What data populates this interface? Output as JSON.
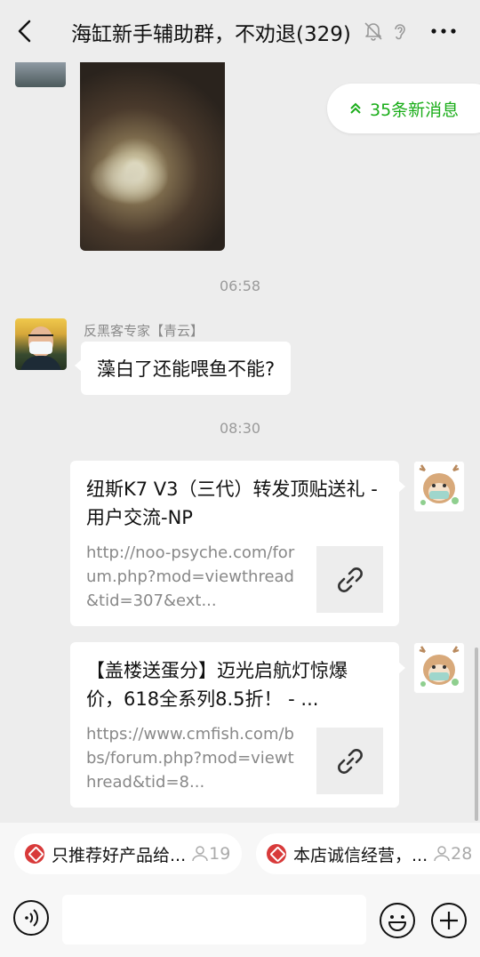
{
  "header": {
    "title": "海缸新手辅助群，不劝退(329)",
    "icons": [
      "back-icon",
      "mute-bell-icon",
      "ear-icon",
      "more-icon"
    ]
  },
  "new_messages": {
    "label": "35条新消息"
  },
  "messages": {
    "time1": "06:58",
    "sender1": "反黑客专家【青云】",
    "text1": "藻白了还能喂鱼不能?",
    "time2": "08:30",
    "link1": {
      "title": "纽斯K7 V3（三代）转发顶贴送礼 - 用户交流-NP",
      "desc": "http://noo-psyche.com/forum.php?mod=viewthread&tid=307&ext..."
    },
    "link2": {
      "title": "【盖楼送蛋分】迈光启航灯惊爆价，618全系列8.5折！ - ...",
      "desc": "https://www.cmfish.com/bbs/forum.php?mod=viewthread&tid=8..."
    }
  },
  "shortcuts": [
    {
      "label": "只推荐好产品给...",
      "count": "19"
    },
    {
      "label": "本店诚信经营，...",
      "count": "28"
    }
  ],
  "input": {
    "value": ""
  },
  "colors": {
    "accent_green": "#1aad19",
    "badge_red": "#d83a3a",
    "background": "#ededed"
  }
}
